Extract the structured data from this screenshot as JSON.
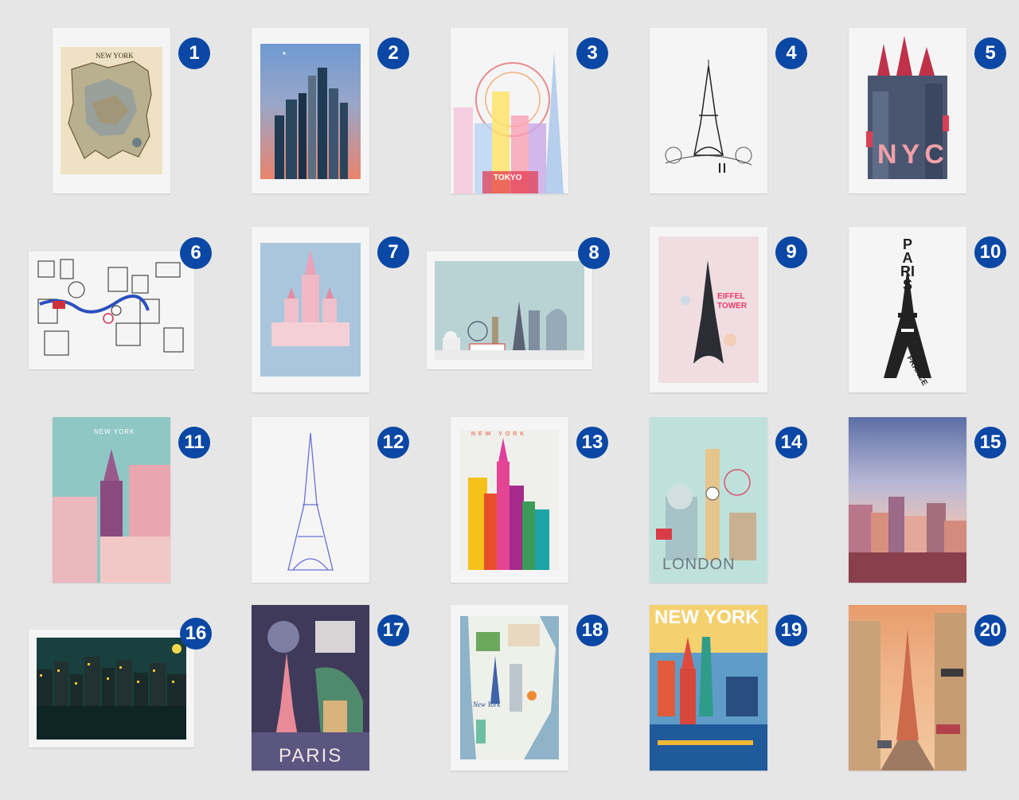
{
  "posters": [
    {
      "number": "1",
      "title": "NEW YORK"
    },
    {
      "number": "2",
      "title": ""
    },
    {
      "number": "3",
      "title": "TOKYO"
    },
    {
      "number": "4",
      "title": ""
    },
    {
      "number": "5",
      "title": "NYC"
    },
    {
      "number": "6",
      "title": ""
    },
    {
      "number": "7",
      "title": ""
    },
    {
      "number": "8",
      "title": ""
    },
    {
      "number": "9",
      "title": "EIFFEL TOWER"
    },
    {
      "number": "10",
      "title_top": "PARIS",
      "title_side": "FRANCE"
    },
    {
      "number": "11",
      "title": "NEW YORK"
    },
    {
      "number": "12",
      "title": ""
    },
    {
      "number": "13",
      "title": "NEW YORK"
    },
    {
      "number": "14",
      "title": "LONDON"
    },
    {
      "number": "15",
      "title": ""
    },
    {
      "number": "16",
      "title": ""
    },
    {
      "number": "17",
      "title": "PARIS"
    },
    {
      "number": "18",
      "title": "New York"
    },
    {
      "number": "19",
      "title": "NEW YORK"
    },
    {
      "number": "20",
      "title": ""
    }
  ],
  "colors": {
    "background": "#e6e6e6",
    "badge": "#0b47a4",
    "card": "#f5f5f5"
  }
}
